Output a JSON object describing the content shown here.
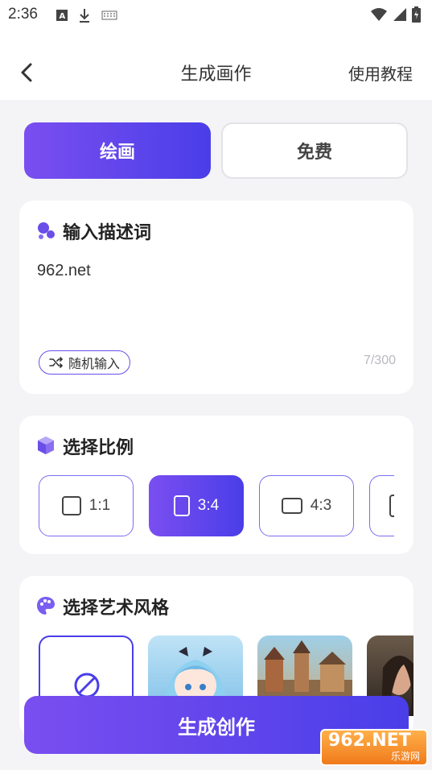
{
  "status_bar": {
    "time": "2:36",
    "left_icons": [
      "font-a-icon",
      "download-icon",
      "keyboard-icon"
    ],
    "right_icons": [
      "wifi-icon",
      "signal-icon",
      "battery-charging-icon"
    ]
  },
  "header": {
    "title": "生成画作",
    "tutorial_label": "使用教程",
    "back_icon": "chevron-left-icon"
  },
  "tabs": [
    {
      "label": "绘画",
      "active": true
    },
    {
      "label": "免费",
      "active": false
    }
  ],
  "prompt_card": {
    "title": "输入描述词",
    "value": "962.net",
    "random_label": "随机输入",
    "char_count": "7/300"
  },
  "ratio_card": {
    "title": "选择比例",
    "options": [
      {
        "label": "1:1",
        "active": false
      },
      {
        "label": "3:4",
        "active": true
      },
      {
        "label": "4:3",
        "active": false
      }
    ]
  },
  "style_card": {
    "title": "选择艺术风格"
  },
  "generate_label": "生成创作",
  "watermark": {
    "main": "962.NET",
    "sub": "乐游网"
  },
  "colors": {
    "accent_start": "#7a4ef0",
    "accent_end": "#4a3ee8",
    "background": "#f4f4f6"
  }
}
